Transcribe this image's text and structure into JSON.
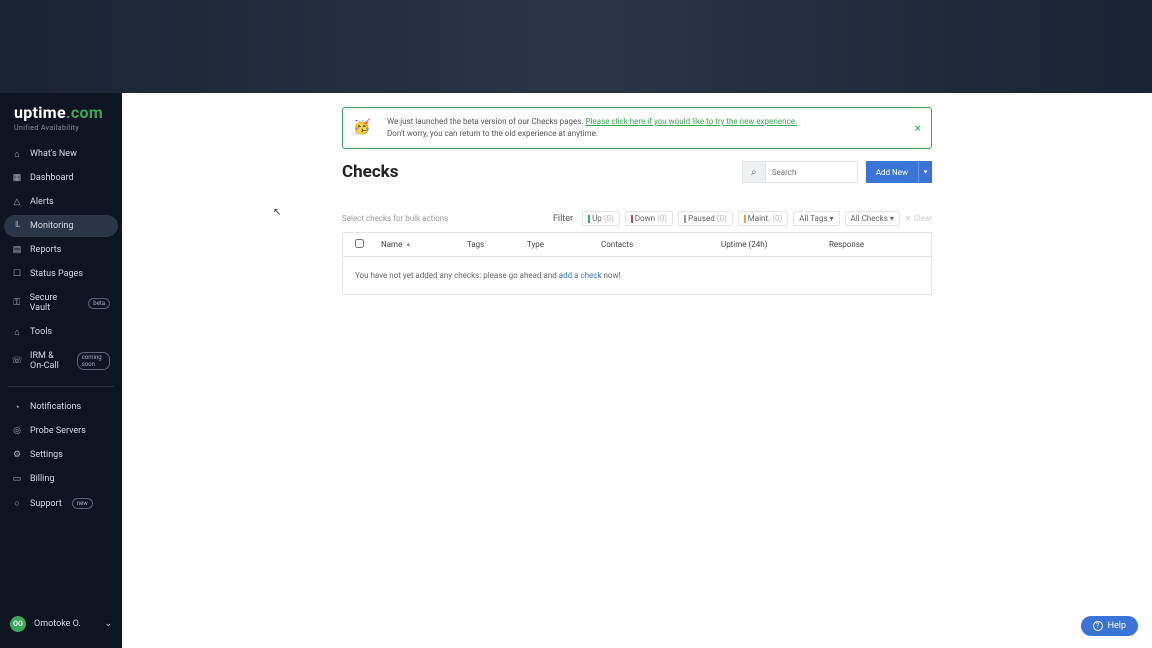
{
  "brand": {
    "name": "uptime",
    "suffix": ".com",
    "tagline": "Unified Availability"
  },
  "sidebar": {
    "items": [
      {
        "icon": "⌂",
        "label": "What's New"
      },
      {
        "icon": "▦",
        "label": "Dashboard"
      },
      {
        "icon": "△",
        "label": "Alerts"
      },
      {
        "icon": "╙",
        "label": "Monitoring",
        "active": true
      },
      {
        "icon": "▤",
        "label": "Reports"
      },
      {
        "icon": "☐",
        "label": "Status Pages"
      },
      {
        "icon": "⚿",
        "label": "Secure Vault",
        "badge": "beta"
      },
      {
        "icon": "⌂",
        "label": "Tools"
      },
      {
        "icon": "☏",
        "label": "IRM & On-Call",
        "badge": "coming soon"
      }
    ],
    "secondary": [
      {
        "icon": "◔",
        "label": "Notifications"
      },
      {
        "icon": "◎",
        "label": "Probe Servers"
      },
      {
        "icon": "⚙",
        "label": "Settings"
      },
      {
        "icon": "▭",
        "label": "Billing"
      },
      {
        "icon": "○",
        "label": "Support",
        "badge": "new"
      }
    ]
  },
  "user": {
    "initials": "OO",
    "name": "Omotoke O."
  },
  "banner": {
    "text1": "We just launched the beta version of our Checks pages. ",
    "link": "Please click here if you would like to try the new experience.",
    "text2": "Don't worry, you can return to the old experience at anytime."
  },
  "page": {
    "title": "Checks"
  },
  "search": {
    "placeholder": "Search"
  },
  "buttons": {
    "add": "Add New"
  },
  "filter": {
    "bulk_hint": "Select checks for bulk actions",
    "label": "Filter",
    "up": "Up",
    "down": "Down",
    "paused": "Paused",
    "maint": "Maint.",
    "up_cnt": "(0)",
    "down_cnt": "(0)",
    "paused_cnt": "(0)",
    "maint_cnt": "(0)",
    "tags": "All Tags",
    "checks": "All Checks",
    "clear": "✕ Clear"
  },
  "table": {
    "headers": {
      "name": "Name",
      "tags": "Tags",
      "type": "Type",
      "contacts": "Contacts",
      "uptime": "Uptime (24h)",
      "response": "Response"
    },
    "empty_prefix": "You have not yet added any checks: please go ahead and ",
    "empty_link": "add a check",
    "empty_suffix": " now!"
  },
  "help": {
    "label": "Help"
  }
}
